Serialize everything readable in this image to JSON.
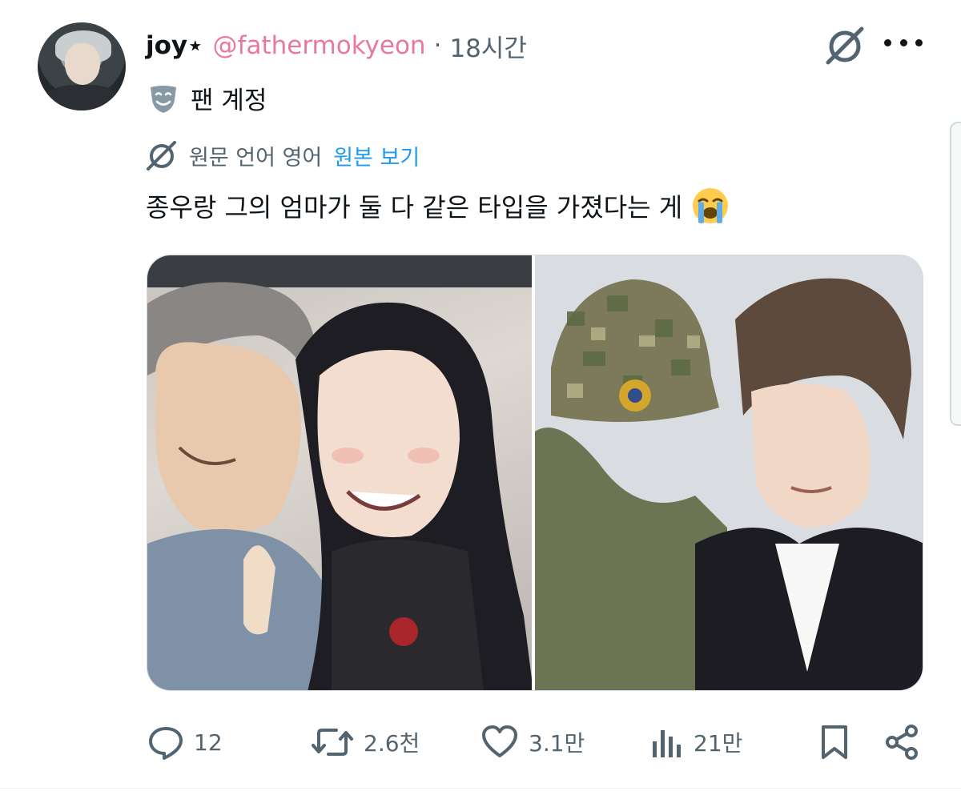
{
  "post": {
    "display_name": "joy⋆",
    "handle": "@fathermokyeon",
    "separator": "·",
    "time": "18시간",
    "account_label": "팬 계정",
    "translation": {
      "source_language": "원문 언어 영어",
      "show_original": "원본 보기"
    },
    "text": "종우랑 그의 엄마가 둘 다 같은 타입을 가졌다는 게",
    "emoji": "loudly-crying-face",
    "images": [
      {
        "icon": "illustration-couple-selfie"
      },
      {
        "icon": "illustration-soldier-and-man"
      }
    ]
  },
  "actions": {
    "replies": "12",
    "reposts": "2.6천",
    "likes": "3.1만",
    "views": "21만"
  },
  "colors": {
    "handle": "#e8799c",
    "link": "#1d9bf0",
    "muted": "#536471",
    "text": "#0f1419"
  },
  "icons": {
    "more": "more-dots-icon",
    "grok": "grok-icon",
    "fan": "theater-mask-icon",
    "reply": "reply-icon",
    "repost": "repost-icon",
    "like": "heart-icon",
    "views": "views-bar-chart-icon",
    "bookmark": "bookmark-icon",
    "share": "share-icon"
  }
}
